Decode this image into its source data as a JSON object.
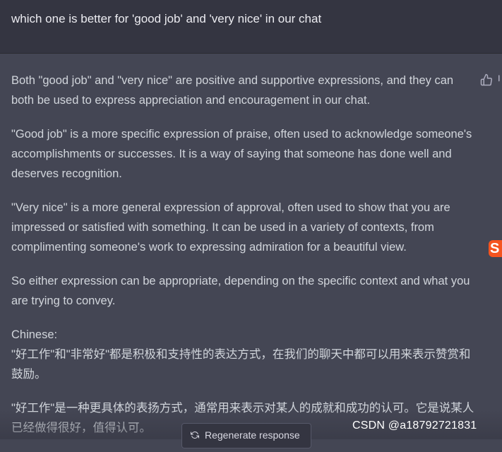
{
  "user_message": {
    "text": "which one is better for 'good job' and 'very nice' in our chat"
  },
  "assistant_message": {
    "paragraphs": [
      "Both \"good job\" and \"very nice\" are positive and supportive expressions, and they can both be used to express appreciation and encouragement in our chat.",
      "\"Good job\" is a more specific expression of praise, often used to acknowledge someone's accomplishments or successes. It is a way of saying that someone has done well and deserves recognition.",
      "\"Very nice\" is a more general expression of approval, often used to show that you are impressed or satisfied with something. It can be used in a variety of contexts, from complimenting someone's work to expressing admiration for a beautiful view.",
      "So either expression can be appropriate, depending on the specific context and what you are trying to convey."
    ],
    "chinese_label": "Chinese:",
    "chinese_paragraphs": [
      "\"好工作\"和\"非常好\"都是积极和支持性的表达方式，在我们的聊天中都可以用来表示赞赏和鼓励。",
      "\"好工作\"是一种更具体的表扬方式，通常用来表示对某人的成就和成功的认可。它是说某人已经做得很好，值得认可。"
    ]
  },
  "actions": {
    "thumb_icon": "thumbs-up-icon",
    "regenerate_label": "Regenerate response",
    "regenerate_icon": "refresh-icon"
  },
  "overlay": {
    "sogou_badge_text": "S",
    "watermark": "CSDN @a18792721831"
  },
  "colors": {
    "user_bg": "#343541",
    "assistant_bg": "#444654",
    "text": "#d1d5db",
    "sogou": "#f5541f"
  }
}
